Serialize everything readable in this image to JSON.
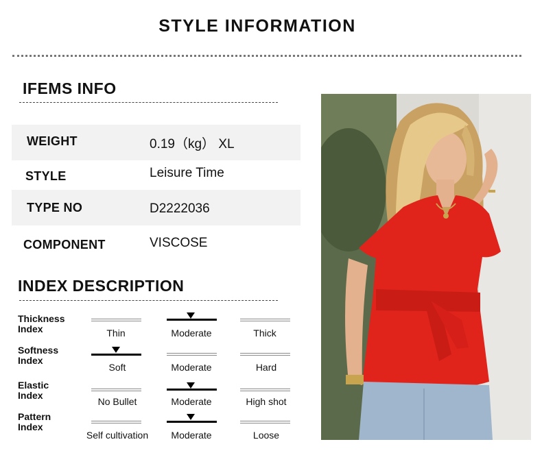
{
  "header": {
    "title": "STYLE INFORMATION"
  },
  "items_info": {
    "heading": "IFEMS INFO",
    "rows": [
      {
        "key": "WEIGHT",
        "value": "0.19（kg） XL"
      },
      {
        "key": "STYLE",
        "value": "Leisure Time"
      },
      {
        "key": "TYPE NO",
        "value": "D2222036"
      },
      {
        "key": "COMPONENT",
        "value": "VISCOSE"
      }
    ]
  },
  "index_description": {
    "heading": "INDEX DESCRIPTION",
    "indices": [
      {
        "line1": "Thickness",
        "line2": "Index",
        "options": [
          "Thin",
          "Moderate",
          "Thick"
        ],
        "selected": 1
      },
      {
        "line1": "Softness",
        "line2": "Index",
        "options": [
          "Soft",
          "Moderate",
          "Hard"
        ],
        "selected": 0
      },
      {
        "line1": "Elastic",
        "line2": "Index",
        "options": [
          "No Bullet",
          "Moderate",
          "High shot"
        ],
        "selected": 1
      },
      {
        "line1": "Pattern",
        "line2": "Index",
        "options": [
          "Self cultivation",
          "Moderate",
          "Loose"
        ],
        "selected": 1
      }
    ]
  },
  "colors": {
    "blouse": "#e0241c",
    "hair": "#e6c98a",
    "denim": "#9fb6cc",
    "background": "#d9d7d1"
  },
  "image": {
    "subject": "model-wearing-red-belted-v-neck-blouse"
  }
}
